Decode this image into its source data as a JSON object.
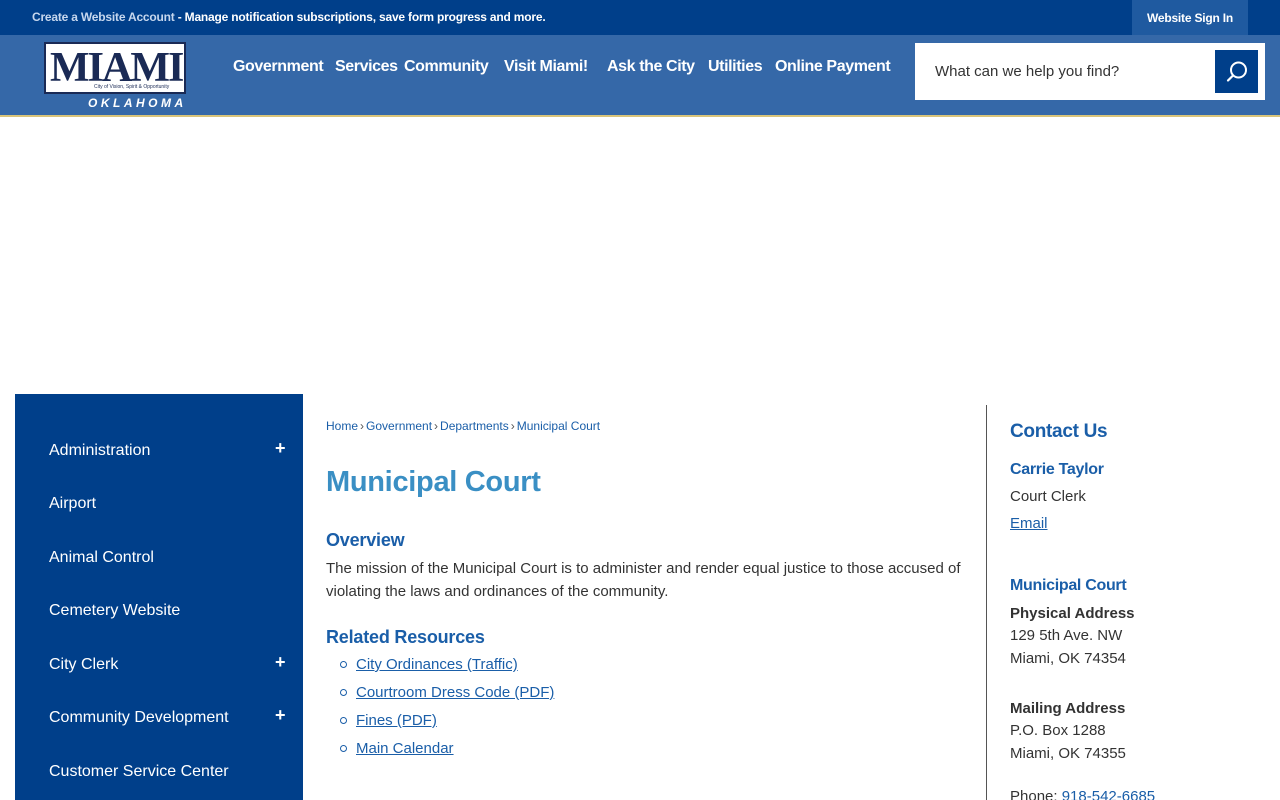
{
  "topbar": {
    "create_link": "Create a Website Account",
    "create_text": " - Manage notification subscriptions, save form progress and more.",
    "signin": "Website Sign In"
  },
  "logo": {
    "word": "MIAMI",
    "tagline": "City of Vision, Spirit & Opportunity",
    "state": "OKLAHOMA"
  },
  "nav": [
    "Government",
    "Services",
    "Community",
    "Visit Miami!",
    "Ask the City",
    "Utilities",
    "Online Payment"
  ],
  "search": {
    "placeholder": "What can we help you find?"
  },
  "sidebar": {
    "items": [
      {
        "label": "Administration",
        "expandable": "+"
      },
      {
        "label": "Airport"
      },
      {
        "label": "Animal Control"
      },
      {
        "label": "Cemetery Website"
      },
      {
        "label": "City Clerk",
        "expandable": "+"
      },
      {
        "label": "Community Development",
        "expandable": "+"
      },
      {
        "label": "Customer Service Center"
      }
    ]
  },
  "breadcrumb": [
    "Home",
    "Government",
    "Departments",
    "Municipal Court"
  ],
  "breadcrumb_sep": "›",
  "main": {
    "title": "Municipal Court",
    "overview_heading": "Overview",
    "overview_text": "The mission of the Municipal Court is to administer and render equal justice to those accused of violating the laws and ordinances of the community.",
    "resources_heading": "Related Resources",
    "resources": [
      "City Ordinances (Traffic)",
      "Courtroom Dress Code (PDF)",
      "Fines (PDF)",
      "Main Calendar"
    ]
  },
  "contact": {
    "title": "Contact Us",
    "name": "Carrie Taylor",
    "role": "Court Clerk",
    "email": "Email",
    "dept": "Municipal Court",
    "physical_label": "Physical Address",
    "physical_line1": "129 5th Ave. NW",
    "physical_line2": "Miami, OK 74354",
    "mailing_label": "Mailing Address",
    "mailing_line1": "P.O. Box 1288",
    "mailing_line2": "Miami, OK 74355",
    "phone_label": "Phone:",
    "phone": "918-542-6685"
  },
  "colors": {
    "topbar": "#003f8a",
    "header": "#3568a8",
    "sidebar": "#003f8a",
    "title": "#3a8fc4",
    "link": "#1a5ea8"
  }
}
